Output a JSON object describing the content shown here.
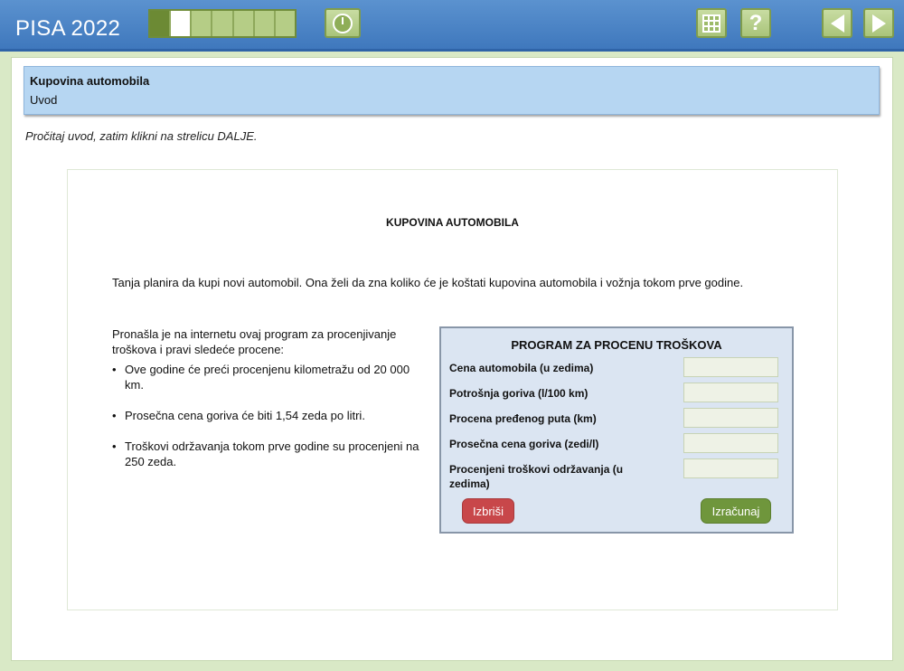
{
  "app": {
    "title": "PISA 2022"
  },
  "toolbar": {
    "progress_segments": [
      "done",
      "current",
      "todo",
      "todo",
      "todo",
      "todo",
      "todo"
    ],
    "icons": [
      "timer-icon",
      "calculator-icon",
      "help-icon",
      "previous-arrow-icon",
      "next-arrow-icon"
    ],
    "help_glyph": "?"
  },
  "header": {
    "unit_title": "Kupovina automobila",
    "subtitle": "Uvod"
  },
  "instruction": "Pročitaj uvod, zatim klikni na strelicu DALJE.",
  "stimulus": {
    "title": "KUPOVINA AUTOMOBILA",
    "intro": "Tanja planira da kupi novi automobil. Ona želi da zna koliko će je koštati kupovina automobila i vožnja tokom prve godine.",
    "paragraph": "Pronašla je na internetu ovaj program za procenjivanje troškova i pravi sledeće procene:",
    "bullets": [
      "Ove godine će preći procenjenu kilometražu od 20 000 km.",
      "Prosečna cena goriva će biti 1,54 zeda po litri.",
      "Troškovi održavanja tokom prve godine su procenjeni na 250 zeda."
    ]
  },
  "calculator": {
    "title": "PROGRAM ZA PROCENU TROŠKOVA",
    "fields": [
      {
        "label": "Cena automobila (u zedima)",
        "value": ""
      },
      {
        "label": "Potrošnja goriva (l/100 km)",
        "value": ""
      },
      {
        "label": "Procena pređenog puta (km)",
        "value": ""
      },
      {
        "label": "Prosečna cena goriva (zedi/l)",
        "value": ""
      },
      {
        "label": "Procenjeni troškovi održavanja (u zedima)",
        "value": ""
      }
    ],
    "clear_label": "Izbriši",
    "compute_label": "Izračunaj"
  },
  "colors": {
    "topbar": "#4a86c8",
    "accent_green": "#6f963c",
    "clear_red": "#c8474a",
    "header_card": "#b6d6f2"
  }
}
